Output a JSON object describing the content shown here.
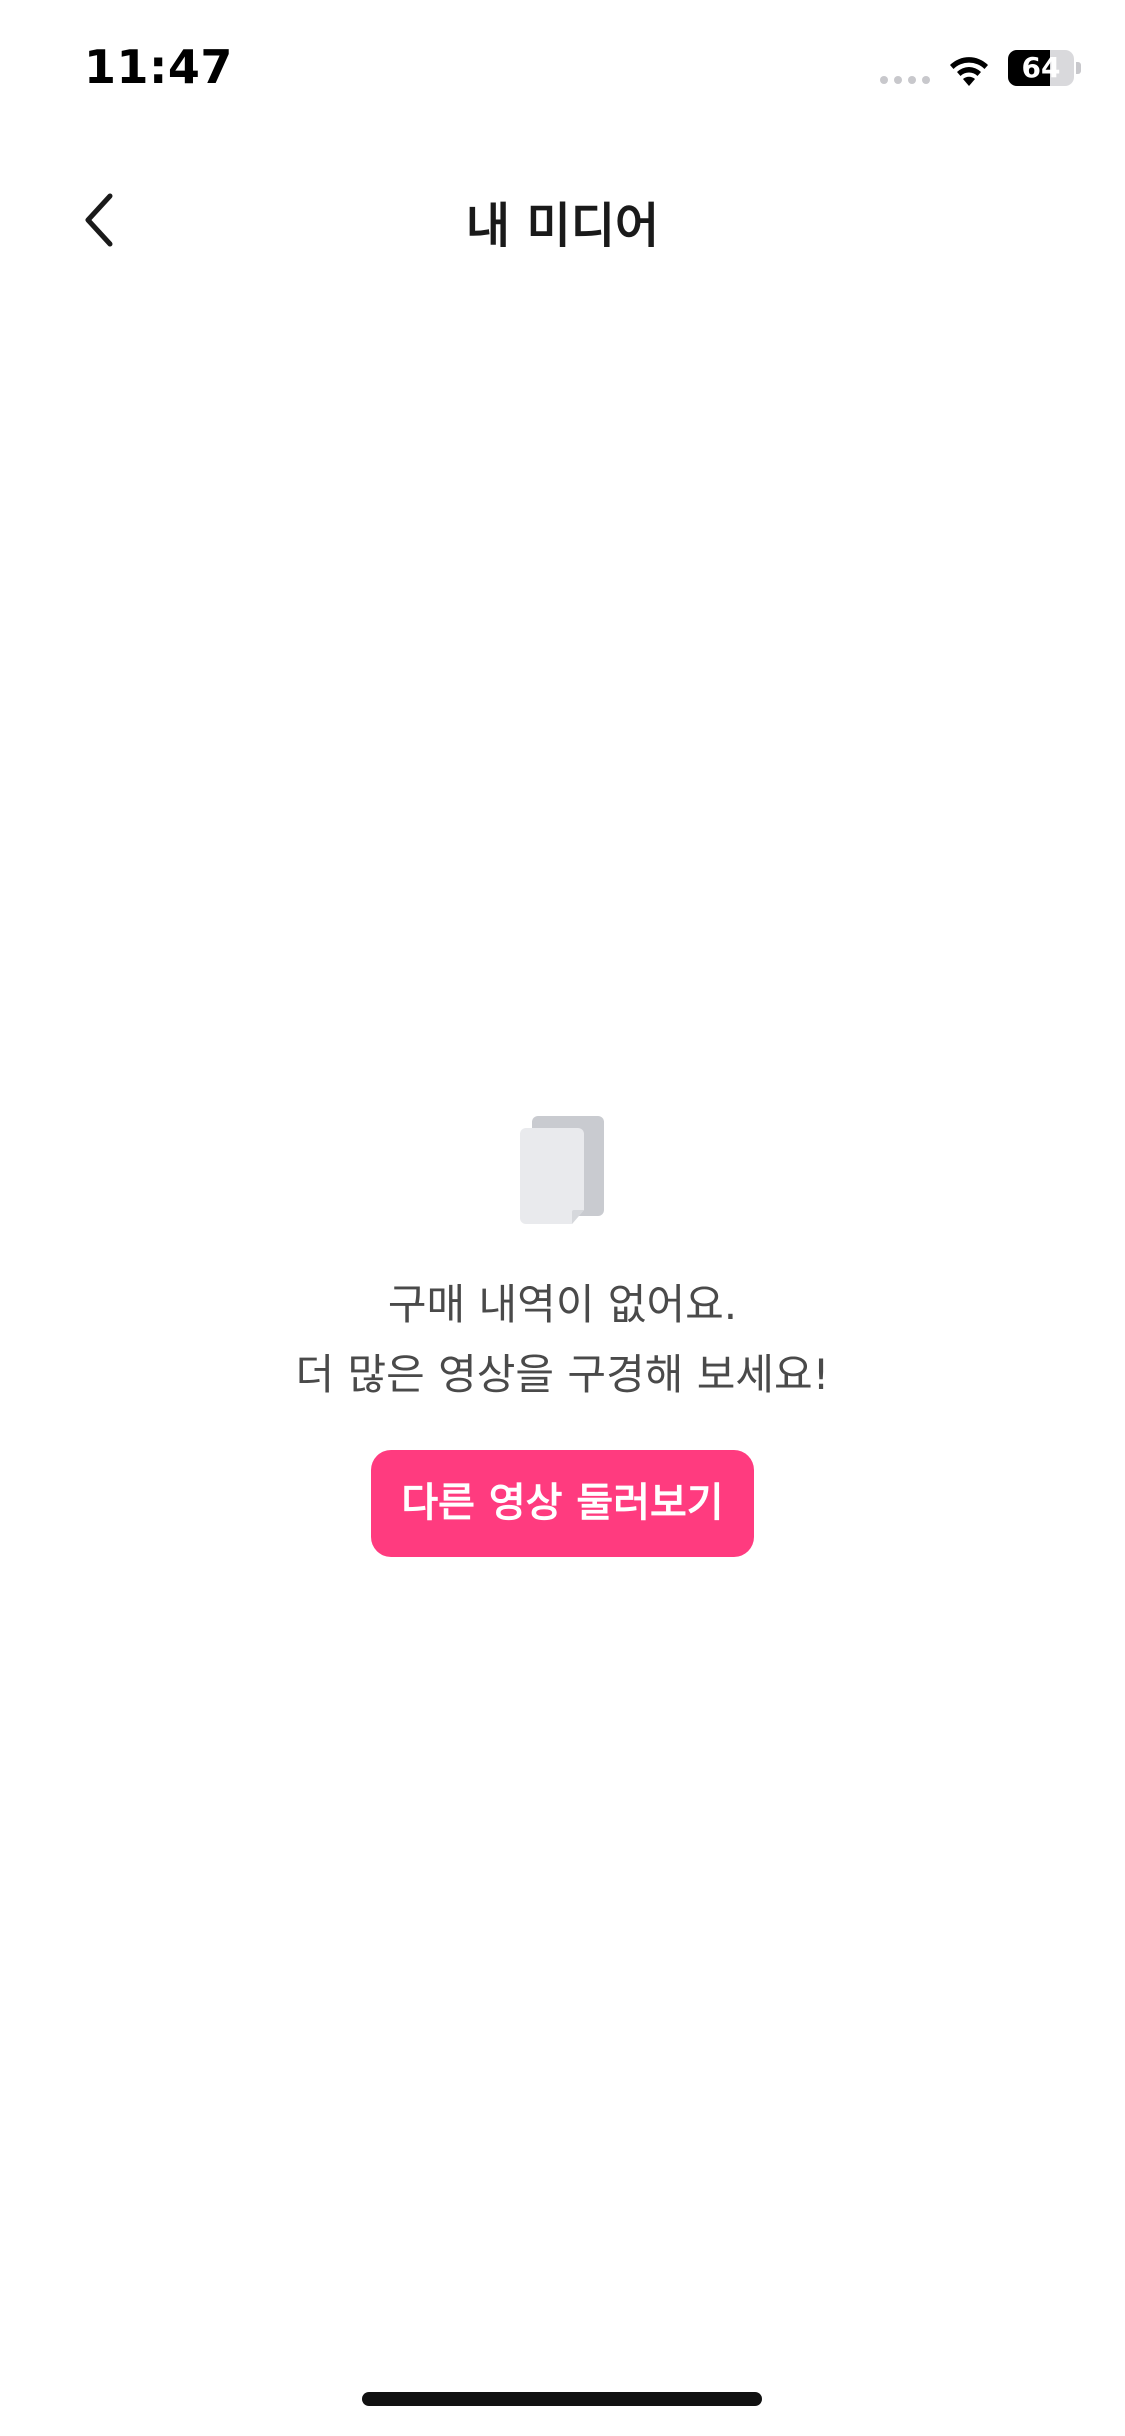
{
  "status_bar": {
    "time": "11:47",
    "battery_level": "64",
    "battery_percent": 64,
    "wifi_icon": "wifi-icon",
    "signal_icon": "signal-dots-icon"
  },
  "nav": {
    "title": "내 미디어",
    "back_icon": "chevron-left-icon"
  },
  "empty_state": {
    "icon": "document-stack-icon",
    "message_line1": "구매 내역이 없어요.",
    "message_line2": "더 많은 영상을 구경해 보세요!",
    "button_label": "다른 영상 둘러보기"
  },
  "colors": {
    "accent": "#ff3b7f",
    "text_primary": "#1a1a1a",
    "text_secondary": "#4a4a4a",
    "icon_light": "#e9eaed",
    "icon_dark": "#c9cbd0",
    "background": "#ffffff"
  }
}
